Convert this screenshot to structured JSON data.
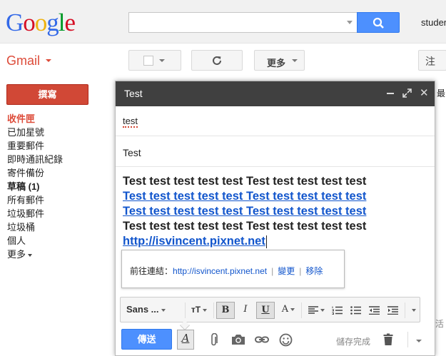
{
  "header": {
    "logo_letters": [
      "G",
      "o",
      "o",
      "g",
      "l",
      "e"
    ],
    "account_name": "studer"
  },
  "toolbar": {
    "app_label": "Gmail",
    "more_label": "更多",
    "note_label": "注",
    "right_truncated": "最",
    "right_truncated2": "活"
  },
  "sidebar": {
    "compose_label": "撰寫",
    "items": [
      {
        "label": "收件匣"
      },
      {
        "label": "已加星號"
      },
      {
        "label": "重要郵件"
      },
      {
        "label": "即時通訊紀錄"
      },
      {
        "label": "寄件備份"
      },
      {
        "label": "草稿 (1)"
      },
      {
        "label": "所有郵件"
      },
      {
        "label": "垃圾郵件"
      },
      {
        "label": "垃圾桶"
      },
      {
        "label": "個人"
      },
      {
        "label": "更多"
      }
    ]
  },
  "compose": {
    "title": "Test",
    "to_value": "test",
    "subject_value": "Test",
    "body_lines": [
      "Test test test test test Test test test test test",
      "Test test test test test Test test test test test",
      "Test test test test test Test test test test test",
      "Test test test test test Test test test test test"
    ],
    "body_link": "http://isvincent.pixnet.net",
    "link_popup": {
      "goto_label": "前往連結：",
      "url": "http://isvincent.pixnet.net",
      "change_label": "變更",
      "remove_label": "移除"
    },
    "format_bar": {
      "font_label": "Sans ...",
      "bold": "B",
      "italic": "I",
      "underline": "U",
      "text_color": "A"
    },
    "send_label": "傳送",
    "format_toggle": "A",
    "saved_label": "儲存完成"
  },
  "colors": {
    "gmail_red": "#dd4b39",
    "compose_red": "#d14836",
    "blue": "#4d90fe",
    "link": "#1155cc",
    "header_dark": "#404040"
  }
}
